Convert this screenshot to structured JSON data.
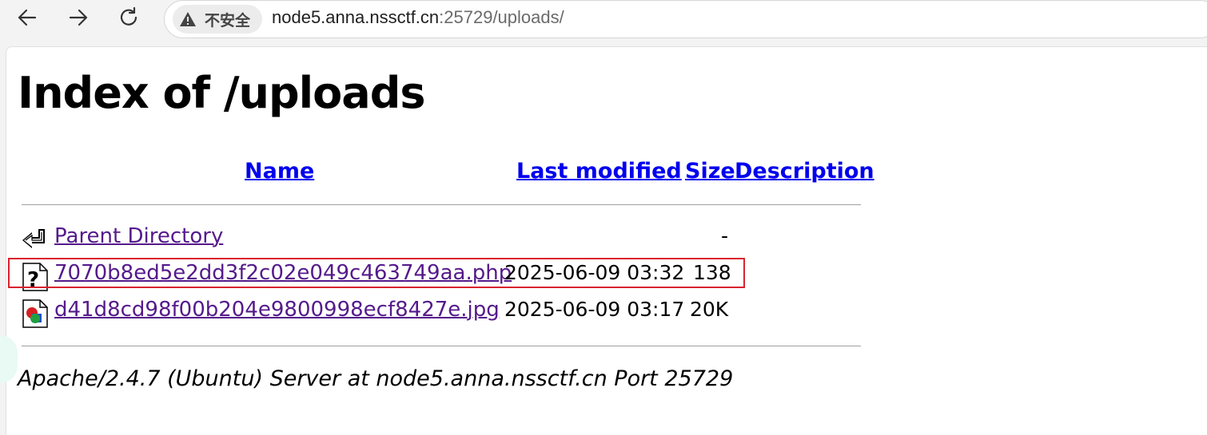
{
  "browser": {
    "security_label": "不安全",
    "url_host": "node5.anna.nssctf.cn",
    "url_rest": ":25729/uploads/"
  },
  "page": {
    "title": "Index of /uploads",
    "columns": {
      "name": "Name",
      "last_modified": "Last modified",
      "size": "Size",
      "description": "Description"
    },
    "rows": [
      {
        "name": "Parent Directory",
        "date": "",
        "size": "-",
        "icon": "back-icon"
      },
      {
        "name": "7070b8ed5e2dd3f2c02e049c463749aa.php",
        "date": "2025-06-09 03:32",
        "size": "138",
        "icon": "unknown-file-icon"
      },
      {
        "name": "d41d8cd98f00b204e9800998ecf8427e.jpg",
        "date": "2025-06-09 03:17",
        "size": "20K",
        "icon": "image-file-icon"
      }
    ],
    "footer": "Apache/2.4.7 (Ubuntu) Server at node5.anna.nssctf.cn Port 25729"
  },
  "colors": {
    "link_unvisited": "#0000ee",
    "link_visited": "#551a8b",
    "highlight": "#d9232d"
  }
}
